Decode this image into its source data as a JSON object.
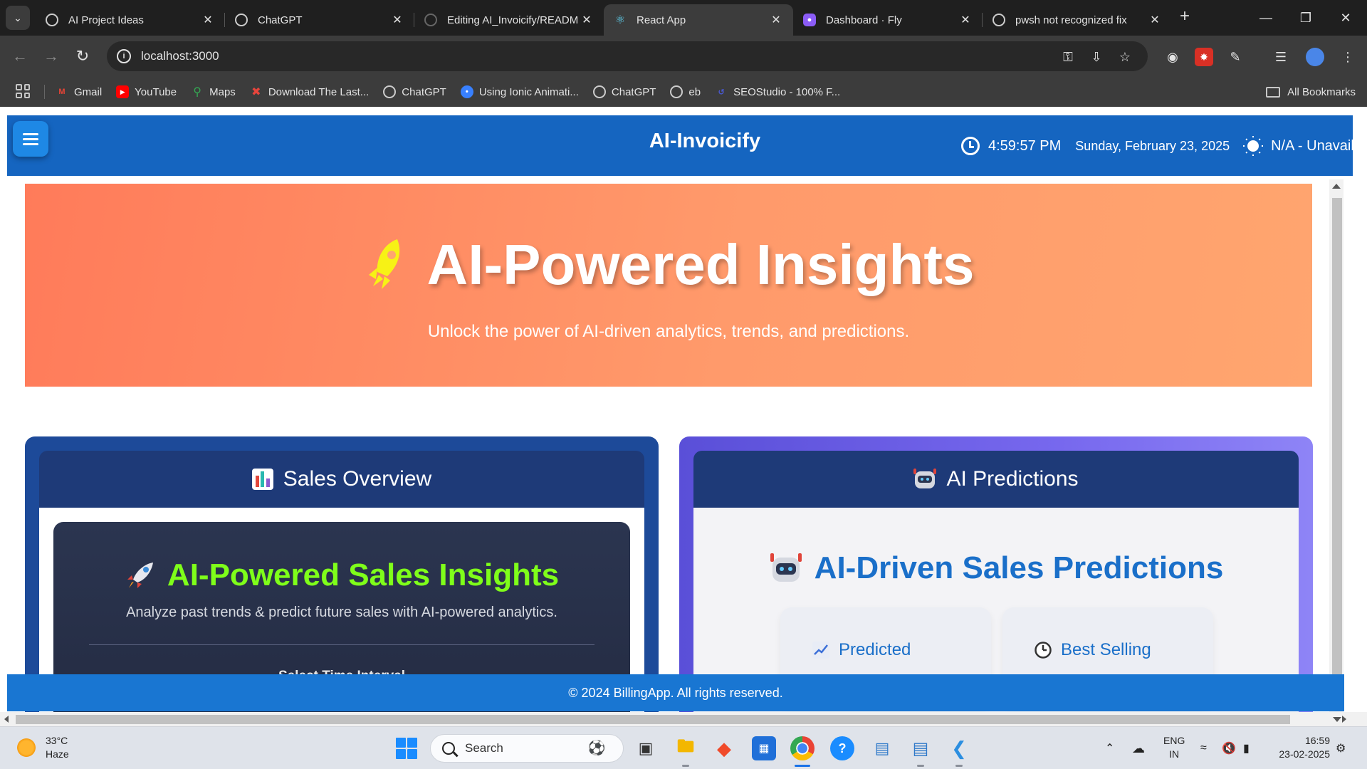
{
  "browser": {
    "tabs": [
      {
        "title": "AI Project Ideas",
        "favicon": "openai-icon"
      },
      {
        "title": "ChatGPT",
        "favicon": "openai-icon"
      },
      {
        "title": "Editing AI_Invoicify/READM",
        "favicon": "github-icon"
      },
      {
        "title": "React App",
        "favicon": "react-icon",
        "active": true
      },
      {
        "title": "Dashboard · Fly",
        "favicon": "fly-icon"
      },
      {
        "title": "pwsh not recognized fix",
        "favicon": "openai-icon"
      }
    ],
    "url": "localhost:3000",
    "bookmarks": [
      {
        "label": "Gmail",
        "icon": "gmail-icon"
      },
      {
        "label": "YouTube",
        "icon": "youtube-icon"
      },
      {
        "label": "Maps",
        "icon": "maps-icon"
      },
      {
        "label": "Download The Last...",
        "icon": "x-icon"
      },
      {
        "label": "ChatGPT",
        "icon": "openai-icon"
      },
      {
        "label": "Using Ionic Animati...",
        "icon": "ionic-icon"
      },
      {
        "label": "ChatGPT",
        "icon": "openai-icon"
      },
      {
        "label": "eb",
        "icon": "openai-icon"
      },
      {
        "label": "SEOStudio - 100% F...",
        "icon": "seostudio-icon"
      }
    ],
    "all_bookmarks": "All Bookmarks"
  },
  "app": {
    "title": "AI-Invoicify",
    "time": "4:59:57 PM",
    "date": "Sunday, February 23, 2025",
    "weather": "N/A - Unavaila"
  },
  "hero": {
    "title": "AI-Powered Insights",
    "subtitle": "Unlock the power of AI-driven analytics, trends, and predictions."
  },
  "sales_card": {
    "header": "Sales Overview",
    "panel_title": "AI-Powered Sales Insights",
    "panel_subtitle": "Analyze past trends & predict future sales with AI-powered analytics.",
    "cut_text": "Select Time Interval"
  },
  "predictions_card": {
    "header": "AI Predictions",
    "title": "AI-Driven Sales Predictions",
    "boxes": [
      {
        "label": "Predicted",
        "icon": "trend-chart-icon"
      },
      {
        "label": "Best Selling",
        "icon": "clock-icon"
      }
    ]
  },
  "footer": {
    "text": "© 2024 BillingApp. All rights reserved."
  },
  "taskbar": {
    "temperature": "33°C",
    "condition": "Haze",
    "search_placeholder": "Search",
    "lang_1": "ENG",
    "lang_2": "IN",
    "clock_time": "16:59",
    "clock_date": "23-02-2025"
  },
  "colors": {
    "app_header": "#1565c0",
    "hero_start": "#ff7b5a",
    "hero_end": "#ffa56f",
    "sales_title": "#7fff1a",
    "prediction_title": "#1a6fc9"
  }
}
